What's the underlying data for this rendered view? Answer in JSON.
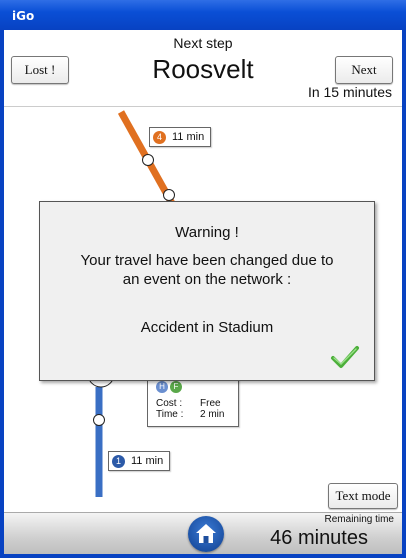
{
  "window": {
    "title": "iGo"
  },
  "header": {
    "lost_label": "Lost !",
    "next_label": "Next",
    "next_step_label": "Next step",
    "station": "Roosvelt",
    "eta": "In 15 minutes"
  },
  "map": {
    "line4": {
      "number": "4",
      "time": "11 min",
      "color": "#e07020"
    },
    "line1": {
      "number": "1",
      "time": "11 min",
      "color": "#3a6fc4"
    },
    "info": {
      "icons": [
        "H",
        "F"
      ],
      "cost_label": "Cost :",
      "cost_value": "Free",
      "time_label": "Time :",
      "time_value": "2 min"
    }
  },
  "dialog": {
    "title": "Warning !",
    "line1": "Your travel have been changed due to",
    "line2": "an event on the network :",
    "event": "Accident in Stadium",
    "confirm_icon": "checkmark-icon"
  },
  "footer": {
    "text_mode_label": "Text mode",
    "remaining_label": "Remaining time",
    "remaining_value": "46 minutes",
    "home_icon": "home-icon"
  }
}
